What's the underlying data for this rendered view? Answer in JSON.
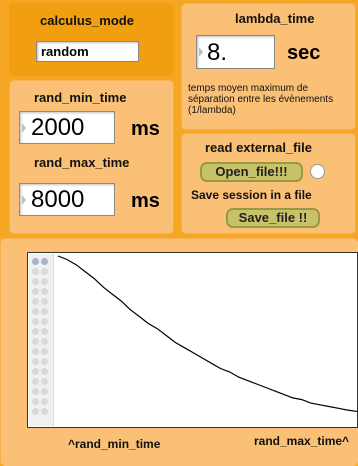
{
  "calculus_mode": {
    "title": "calculus_mode",
    "value": "random"
  },
  "lambda_time": {
    "title": "lambda_time",
    "value": "8.",
    "unit": "sec",
    "description": "temps moyen maximum de séparation entre les évènements (1/lambda)"
  },
  "rand_min_time": {
    "title": "rand_min_time",
    "value": "2000",
    "unit": "ms"
  },
  "rand_max_time": {
    "title": "rand_max_time",
    "value": "8000",
    "unit": "ms"
  },
  "file": {
    "read_title": "read external_file",
    "open_button": "Open_file!!!",
    "save_title": "Save session in a file",
    "save_button": "Save_file !!"
  },
  "graph": {
    "x_min_label": "^rand_min_time",
    "x_max_label": "rand_max_time^",
    "curve": [
      [
        0.0,
        1.0
      ],
      [
        0.03,
        0.98
      ],
      [
        0.06,
        0.95
      ],
      [
        0.09,
        0.91
      ],
      [
        0.12,
        0.87
      ],
      [
        0.15,
        0.82
      ],
      [
        0.18,
        0.78
      ],
      [
        0.21,
        0.74
      ],
      [
        0.24,
        0.69
      ],
      [
        0.27,
        0.65
      ],
      [
        0.3,
        0.61
      ],
      [
        0.33,
        0.58
      ],
      [
        0.36,
        0.54
      ],
      [
        0.39,
        0.5
      ],
      [
        0.42,
        0.47
      ],
      [
        0.45,
        0.44
      ],
      [
        0.48,
        0.41
      ],
      [
        0.51,
        0.38
      ],
      [
        0.54,
        0.35
      ],
      [
        0.57,
        0.33
      ],
      [
        0.6,
        0.3
      ],
      [
        0.63,
        0.28
      ],
      [
        0.66,
        0.26
      ],
      [
        0.69,
        0.24
      ],
      [
        0.72,
        0.22
      ],
      [
        0.75,
        0.2
      ],
      [
        0.78,
        0.18
      ],
      [
        0.81,
        0.17
      ],
      [
        0.84,
        0.15
      ],
      [
        0.87,
        0.14
      ],
      [
        0.9,
        0.13
      ],
      [
        0.93,
        0.12
      ],
      [
        0.96,
        0.11
      ],
      [
        1.0,
        0.1
      ]
    ]
  }
}
